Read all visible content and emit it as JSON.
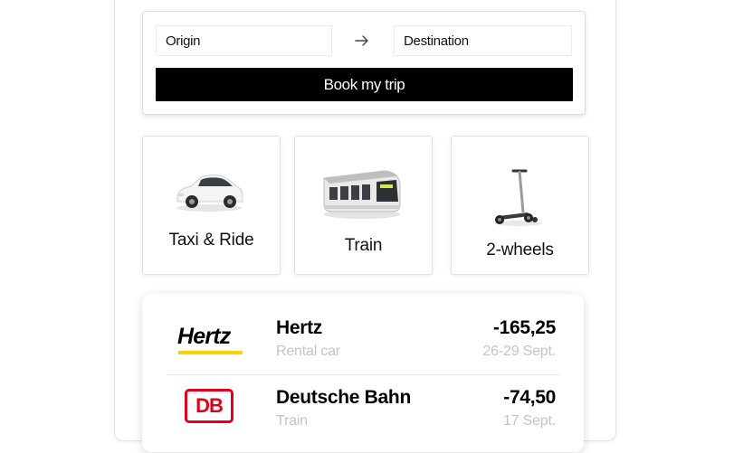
{
  "search": {
    "origin_placeholder": "Origin",
    "destination_placeholder": "Destination",
    "arrow_icon": "arrow-right-icon",
    "book_label": "Book my trip"
  },
  "modes": [
    {
      "label": "Taxi & Ride",
      "icon": "car-icon"
    },
    {
      "label": "Train",
      "icon": "train-icon"
    },
    {
      "label": "2-wheels",
      "icon": "scooter-icon"
    }
  ],
  "transactions": [
    {
      "logo": "Hertz",
      "name": "Hertz",
      "category": "Rental car",
      "amount": "-165,25",
      "date": "26-29 Sept."
    },
    {
      "logo": "DB",
      "name": "Deutsche Bahn",
      "category": "Train",
      "amount": "-74,50",
      "date": "17 Sept."
    }
  ],
  "colors": {
    "primary_button": "#000000",
    "muted_text": "#c4c4c4",
    "hertz_yellow": "#ffd100",
    "db_red": "#e2001a"
  }
}
